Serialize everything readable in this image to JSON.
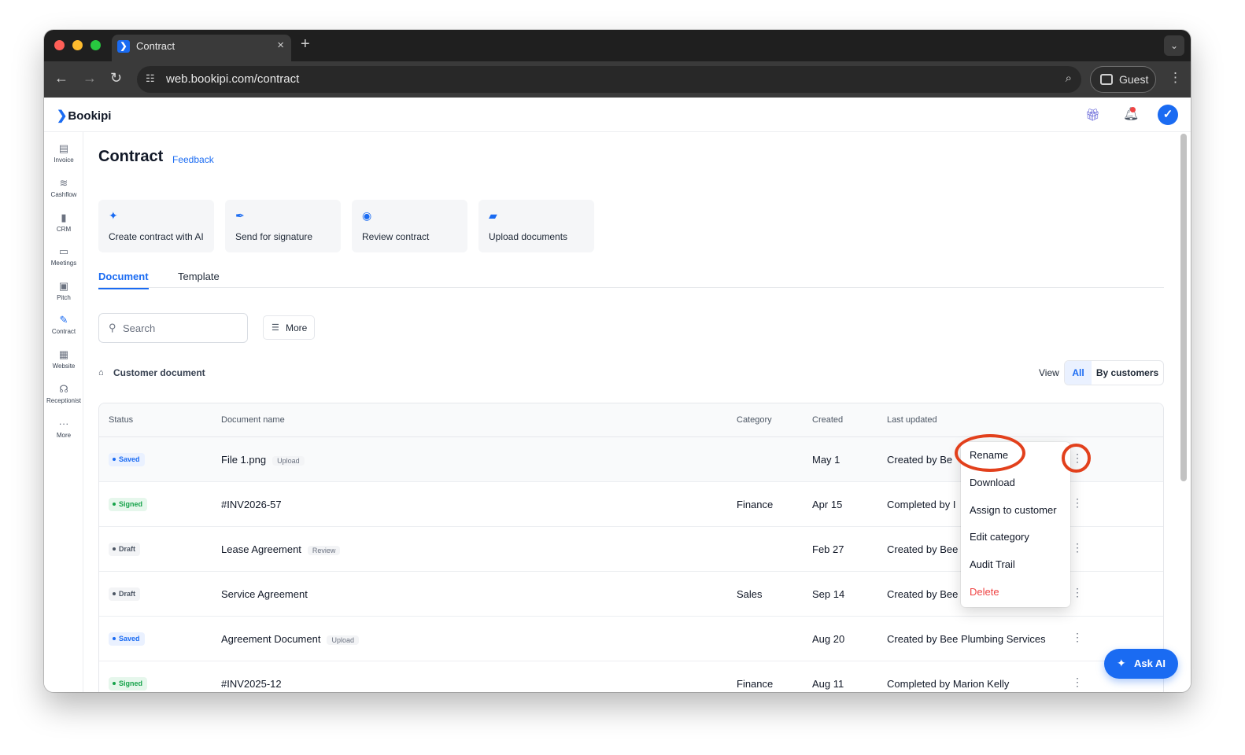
{
  "colors": {
    "accent": "#1a6bf2",
    "danger": "#ef4444",
    "signed": "#16a34a",
    "annotation": "#e2401c"
  },
  "browser": {
    "tab_title": "Contract",
    "tab_favicon": "bookipi-favicon-icon",
    "close_icon": "×",
    "new_tab_icon": "+",
    "tab_menu_icon": "⌄",
    "url": "web.bookipi.com/contract",
    "profile_label": "Guest",
    "back_icon": "←",
    "forward_icon": "→",
    "reload_icon": "↻",
    "site_info_icon": "☷",
    "zoom_icon": "⌕",
    "menu_icon": "⋮"
  },
  "app": {
    "logo": "Bookipi",
    "header_icons": [
      "gift-icon",
      "bell-icon",
      "avatar-icon"
    ]
  },
  "sidebar": {
    "items": [
      {
        "label": "Invoice",
        "icon": "▤"
      },
      {
        "label": "Cashflow",
        "icon": "≋"
      },
      {
        "label": "CRM",
        "icon": "▮"
      },
      {
        "label": "Meetings",
        "icon": "▭"
      },
      {
        "label": "Pitch",
        "icon": "▣"
      },
      {
        "label": "Contract",
        "icon": "✎"
      },
      {
        "label": "Website",
        "icon": "▦"
      },
      {
        "label": "Receptionist",
        "icon": "☊"
      },
      {
        "label": "More",
        "icon": "···"
      }
    ]
  },
  "page": {
    "title": "Contract",
    "feedback": "Feedback"
  },
  "actions": [
    {
      "label": "Create contract with AI",
      "icon": "✦"
    },
    {
      "label": "Send for signature",
      "icon": "✒"
    },
    {
      "label": "Review contract",
      "icon": "◉"
    },
    {
      "label": "Upload documents",
      "icon": "▰"
    }
  ],
  "tabs": {
    "document": "Document",
    "template": "Template"
  },
  "search": {
    "placeholder": "Search",
    "value": ""
  },
  "filter": {
    "more_label": "More",
    "icon": "☰"
  },
  "section": {
    "label": "Customer document",
    "icon": "⌂"
  },
  "view": {
    "label": "View",
    "options": [
      "All",
      "By customers"
    ],
    "selected": "All"
  },
  "table": {
    "headers": [
      "Status",
      "Document name",
      "Category",
      "Created",
      "Last updated"
    ],
    "rows": [
      {
        "status": "Saved",
        "name": "File 1.png",
        "tag": "Upload",
        "category": "",
        "created": "May 1",
        "updated": "Created by Be"
      },
      {
        "status": "Signed",
        "name": "#INV2026-57",
        "tag": "",
        "category": "Finance",
        "created": "Apr 15",
        "updated": "Completed by I"
      },
      {
        "status": "Draft",
        "name": "Lease Agreement",
        "tag": "Review",
        "category": "",
        "created": "Feb 27",
        "updated": "Created by Bee"
      },
      {
        "status": "Draft",
        "name": "Service Agreement",
        "tag": "",
        "category": "Sales",
        "created": "Sep 14",
        "updated": "Created by Bee"
      },
      {
        "status": "Saved",
        "name": "Agreement Document",
        "tag": "Upload",
        "category": "",
        "created": "Aug 20",
        "updated": "Created by Bee Plumbing Services"
      },
      {
        "status": "Signed",
        "name": "#INV2025-12",
        "tag": "",
        "category": "Finance",
        "created": "Aug 11",
        "updated": "Completed by Marion Kelly"
      }
    ]
  },
  "context_menu": {
    "items": [
      "Rename",
      "Download",
      "Assign to customer",
      "Edit category",
      "Audit Trail",
      "Delete"
    ]
  },
  "ask_ai": {
    "label": "Ask AI",
    "icon": "✦"
  }
}
